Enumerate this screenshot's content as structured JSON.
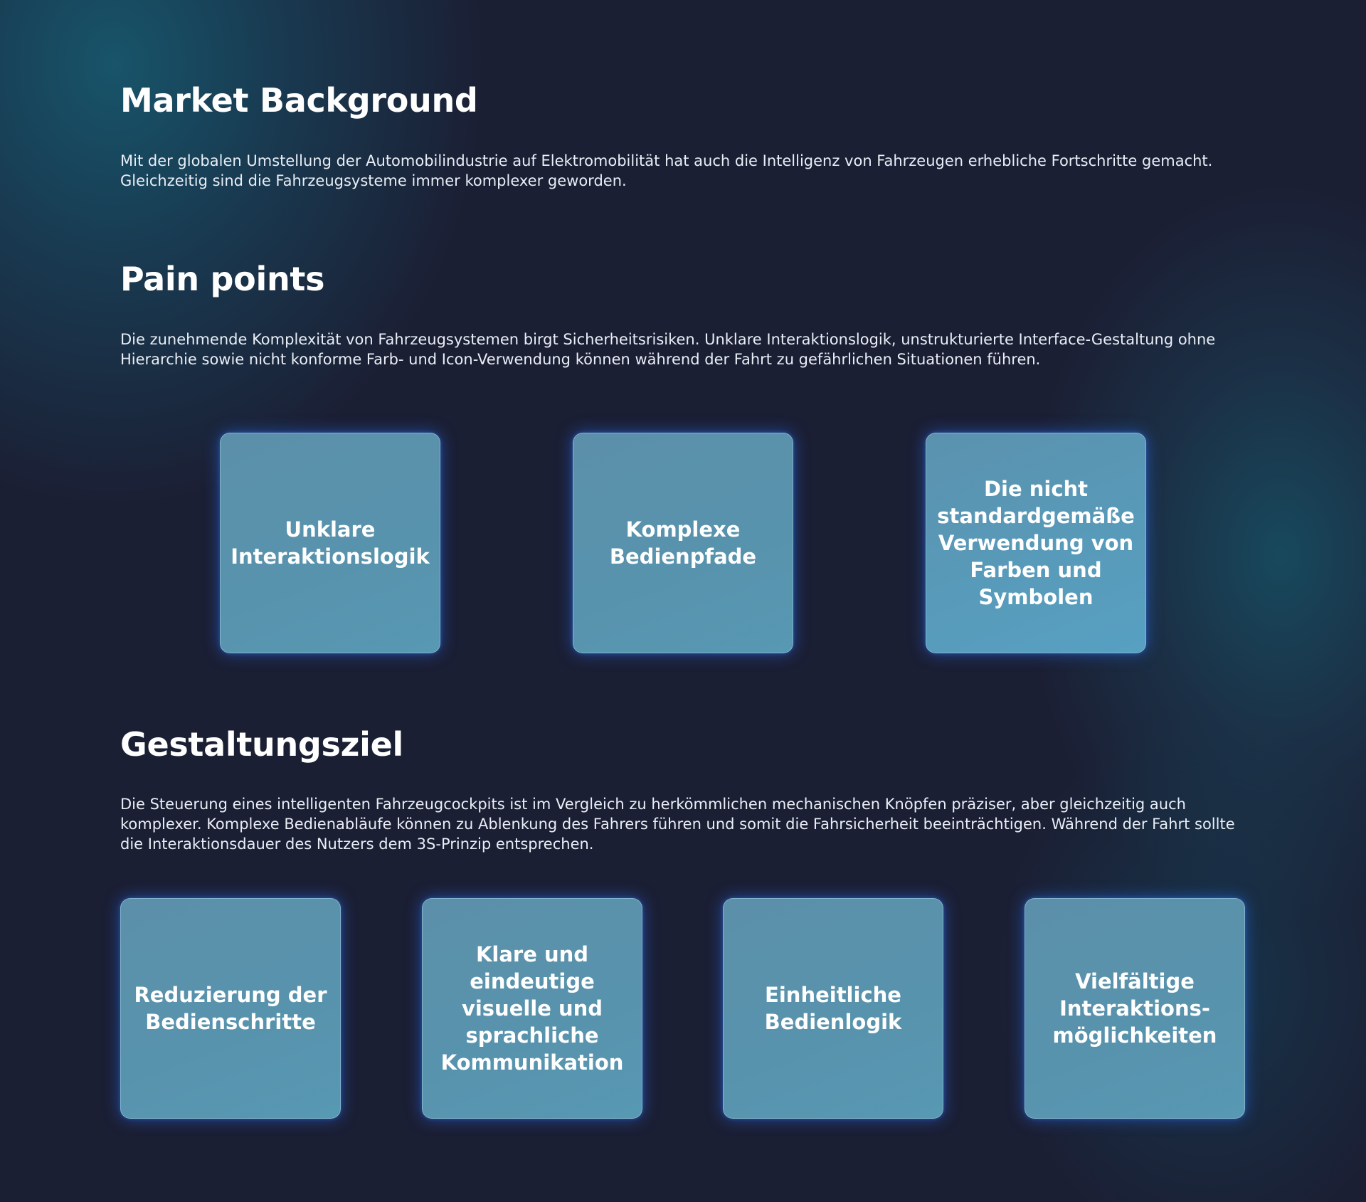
{
  "market": {
    "title": "Market Background",
    "text": "Mit der globalen Umstellung der Automobilindustrie auf Elektromobilität hat auch die Intelligenz von Fahrzeugen erhebliche Fortschritte gemacht. Gleichzeitig sind die Fahrzeugsysteme immer komplexer geworden."
  },
  "pain_points": {
    "title": "Pain points",
    "text": "Die zunehmende Komplexität von Fahrzeugsystemen birgt Sicherheitsrisiken. Unklare Interaktionslogik, unstrukturierte Interface-Gestaltung ohne Hierarchie sowie nicht konforme Farb- und Icon-Verwendung können während der Fahrt zu gefährlichen Situationen führen.",
    "cards": [
      "Unklare Interaktionslogik",
      "Komplexe Bedienpfade",
      "Die nicht standardgemäße Verwendung von Farben und Symbolen"
    ]
  },
  "goal": {
    "title": "Gestaltungsziel",
    "text": "Die Steuerung eines intelligenten Fahrzeugcockpits ist im Vergleich zu herkömmlichen mechanischen Knöpfen präziser, aber gleichzeitig auch komplexer. Komplexe Bedienabläufe können zu Ablenkung des Fahrers führen und somit die Fahrsicherheit beeinträchtigen. Während der Fahrt sollte die Interaktionsdauer des Nutzers dem 3S-Prinzip entsprechen.",
    "cards": [
      "Reduzierung der Bedienschritte",
      "Klare und eindeutige visuelle und sprachliche Kommunikation",
      "Einheitliche Bedienlogik",
      "Vielfältige Interaktions-möglichkeiten"
    ]
  },
  "colors": {
    "background": "#1b1f34",
    "card": "#5893ad",
    "card_glow": "#286eff",
    "text": "#ffffff"
  }
}
